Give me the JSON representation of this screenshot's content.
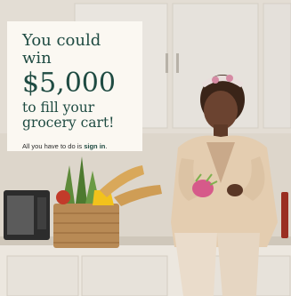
{
  "promo": {
    "line1": "You could win",
    "amount": "$5,000",
    "line3": "to fill your",
    "line4": "grocery cart!",
    "subtext_prefix": "All you have to do is ",
    "subtext_link": "sign in",
    "subtext_suffix": "."
  },
  "colors": {
    "headline": "#1f4b42",
    "panel_background": "#fbf8f2",
    "cabinet": "#e6e2dc",
    "sweater": "#e4cdb0"
  }
}
